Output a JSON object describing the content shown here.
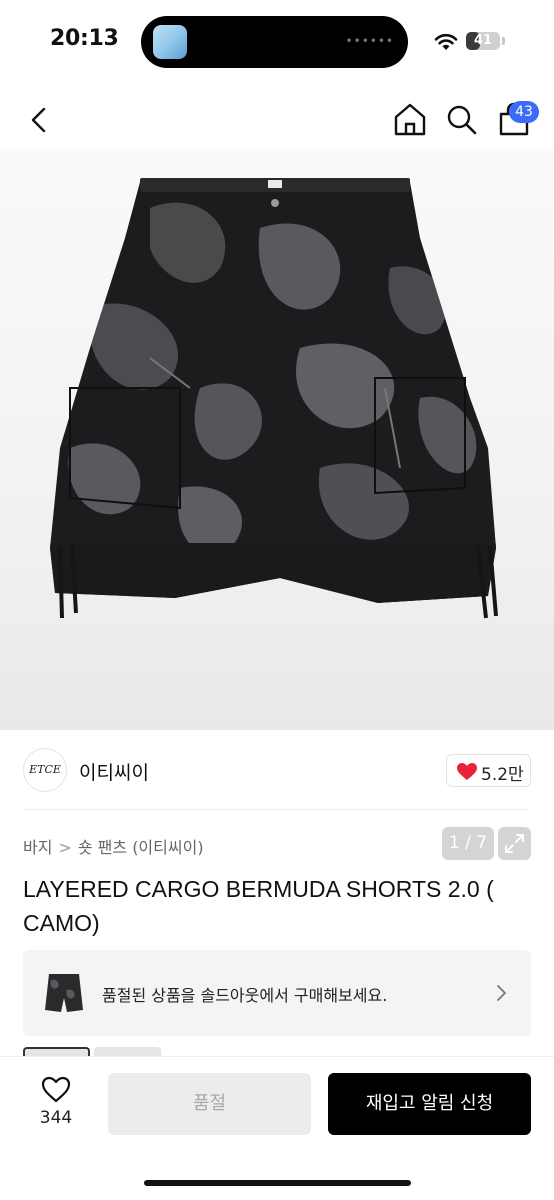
{
  "status_bar": {
    "time": "20:13",
    "battery_level": "41"
  },
  "nav": {
    "cart_count": "43"
  },
  "gallery": {
    "counter": "1 / 7"
  },
  "brand": {
    "logo_text": "ETCE",
    "name": "이티씨이",
    "likes": "5.2만"
  },
  "breadcrumb": {
    "items": [
      "바지",
      "숏 팬츠 (이티씨이)"
    ]
  },
  "product": {
    "title": "LAYERED CARGO BERMUDA SHORTS 2.0 ( CAMO)"
  },
  "soldout_banner": {
    "text": "품절된 상품을 솔드아웃에서 구매해보세요."
  },
  "bottom_bar": {
    "wish_count": "344",
    "soldout_label": "품절",
    "restock_label": "재입고 알림 신청"
  },
  "colors": {
    "badge": "#3b6cf5",
    "like_heart": "#e8233a",
    "primary_button": "#000000"
  }
}
